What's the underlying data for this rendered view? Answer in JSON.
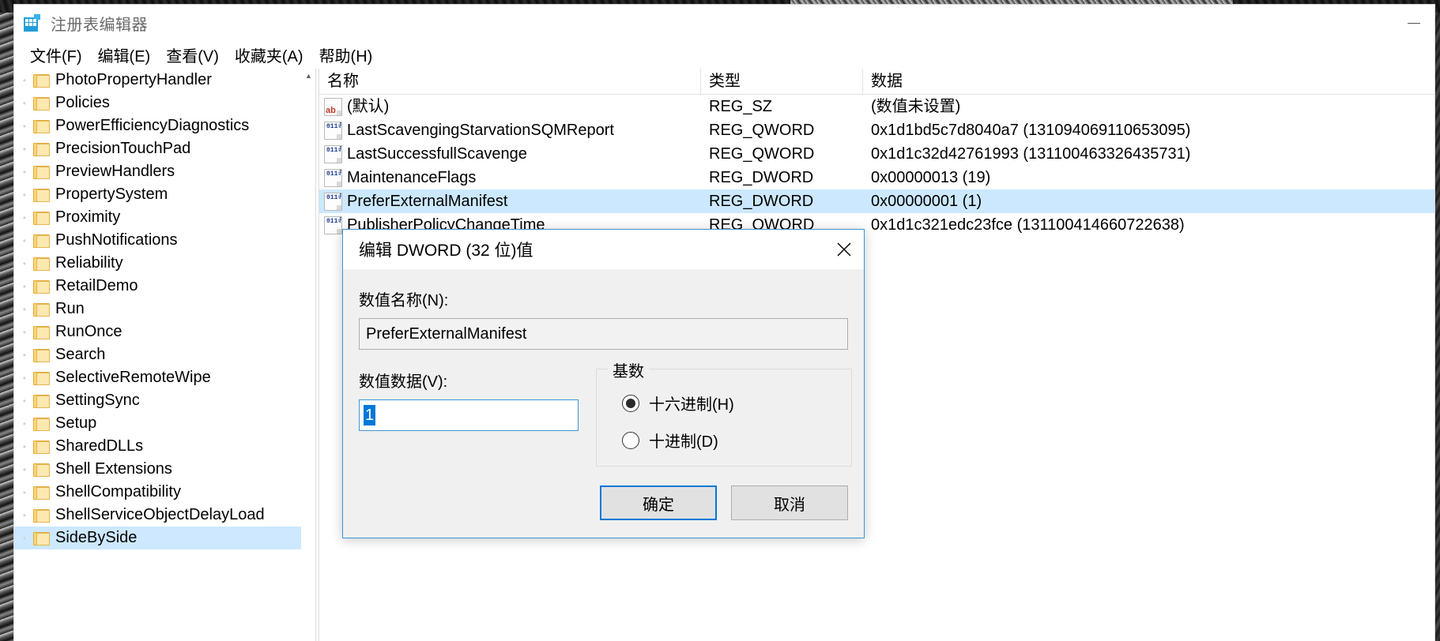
{
  "window": {
    "title": "注册表编辑器",
    "app_icon": "registry-editor-icon",
    "minimize_label": "—"
  },
  "menubar": {
    "items": [
      {
        "text": "文件(F)",
        "label": "文件",
        "mnemonic": "F"
      },
      {
        "text": "编辑(E)",
        "label": "编辑",
        "mnemonic": "E"
      },
      {
        "text": "查看(V)",
        "label": "查看",
        "mnemonic": "V"
      },
      {
        "text": "收藏夹(A)",
        "label": "收藏夹",
        "mnemonic": "A"
      },
      {
        "text": "帮助(H)",
        "label": "帮助",
        "mnemonic": "H"
      }
    ]
  },
  "tree": {
    "items": [
      {
        "label": "PhotoPropertyHandler",
        "selected": false
      },
      {
        "label": "Policies",
        "selected": false
      },
      {
        "label": "PowerEfficiencyDiagnostics",
        "selected": false
      },
      {
        "label": "PrecisionTouchPad",
        "selected": false
      },
      {
        "label": "PreviewHandlers",
        "selected": false
      },
      {
        "label": "PropertySystem",
        "selected": false
      },
      {
        "label": "Proximity",
        "selected": false
      },
      {
        "label": "PushNotifications",
        "selected": false
      },
      {
        "label": "Reliability",
        "selected": false
      },
      {
        "label": "RetailDemo",
        "selected": false
      },
      {
        "label": "Run",
        "selected": false
      },
      {
        "label": "RunOnce",
        "selected": false
      },
      {
        "label": "Search",
        "selected": false
      },
      {
        "label": "SelectiveRemoteWipe",
        "selected": false
      },
      {
        "label": "SettingSync",
        "selected": false
      },
      {
        "label": "Setup",
        "selected": false
      },
      {
        "label": "SharedDLLs",
        "selected": false
      },
      {
        "label": "Shell Extensions",
        "selected": false
      },
      {
        "label": "ShellCompatibility",
        "selected": false
      },
      {
        "label": "ShellServiceObjectDelayLoad",
        "selected": false
      },
      {
        "label": "SideBySide",
        "selected": true
      }
    ],
    "scrollbar": {
      "up_arrow": "▲",
      "down_arrow": "▼"
    }
  },
  "list": {
    "columns": [
      "名称",
      "类型",
      "数据"
    ],
    "rows": [
      {
        "icon": "string-value-icon",
        "name": "(默认)",
        "type": "REG_SZ",
        "data": "(数值未设置)",
        "selected": false
      },
      {
        "icon": "binary-value-icon",
        "name": "LastScavengingStarvationSQMReport",
        "type": "REG_QWORD",
        "data": "0x1d1bd5c7d8040a7 (131094069110653095)",
        "selected": false
      },
      {
        "icon": "binary-value-icon",
        "name": "LastSuccessfullScavenge",
        "type": "REG_QWORD",
        "data": "0x1d1c32d42761993 (131100463326435731)",
        "selected": false
      },
      {
        "icon": "binary-value-icon",
        "name": "MaintenanceFlags",
        "type": "REG_DWORD",
        "data": "0x00000013 (19)",
        "selected": false
      },
      {
        "icon": "binary-value-icon",
        "name": "PreferExternalManifest",
        "type": "REG_DWORD",
        "data": "0x00000001 (1)",
        "selected": true
      },
      {
        "icon": "binary-value-icon",
        "name": "PublisherPolicyChangeTime",
        "type": "REG_QWORD",
        "data": "0x1d1c321edc23fce (131100414660722638)",
        "selected": false
      }
    ]
  },
  "dialog": {
    "title": "编辑 DWORD (32 位)值",
    "close_icon": "close-icon",
    "value_name_label": "数值名称(N):",
    "value_name": "PreferExternalManifest",
    "value_data_label": "数值数据(V):",
    "value_data": "1",
    "radix_legend": "基数",
    "radix_options": [
      {
        "label": "十六进制(H)",
        "selected": true
      },
      {
        "label": "十进制(D)",
        "selected": false
      }
    ],
    "ok_button": "确定",
    "cancel_button": "取消",
    "accent_color": "#0078d7",
    "selection_color": "#0078d7"
  }
}
